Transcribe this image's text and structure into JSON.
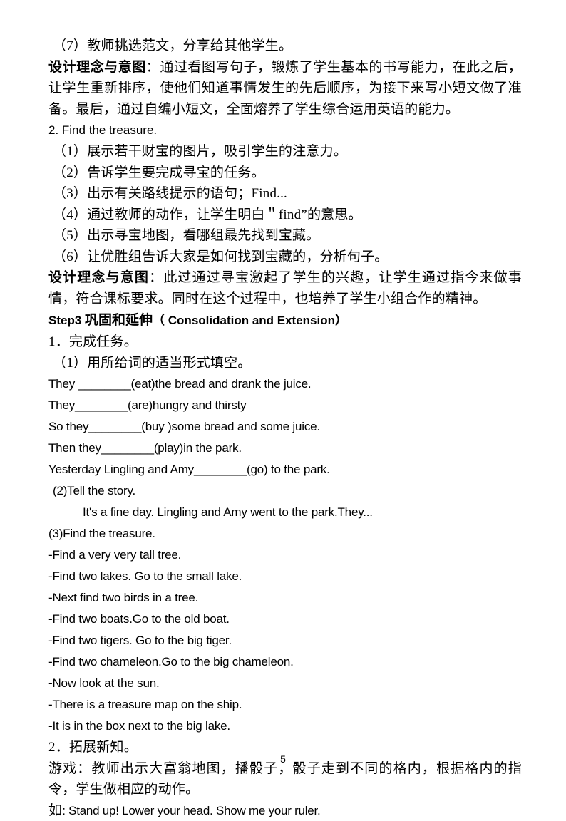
{
  "document": {
    "page_number": "5",
    "body": [
      {
        "id": "item-7",
        "script": "cn",
        "style": "cn",
        "indent": "hang",
        "text": "（7）教师挑选范文，分享给其他学生。"
      },
      {
        "id": "design-intent-1",
        "script": "cn",
        "style": "cn-mixed",
        "lead": "设计理念与意图",
        "text": "：通过看图写句子，锻炼了学生基本的书写能力，在此之后，让学生重新排序，使他们知道事情发生的先后顺序，为接下来写小短文做了准备。最后，通过自编小短文，全面熔养了学生综合运用英语的能力。"
      },
      {
        "id": "task-2-find-treasure",
        "script": "en",
        "style": "en-head",
        "text": "2. Find the treasure."
      },
      {
        "id": "item-2-1",
        "script": "cn",
        "style": "cn",
        "indent": "hang",
        "text": "（1）展示若干财宝的图片，吸引学生的注意力。"
      },
      {
        "id": "item-2-2",
        "script": "cn",
        "style": "cn",
        "indent": "hang",
        "text": "（2）告诉学生要完成寻宝的任务。"
      },
      {
        "id": "item-2-3",
        "script": "cn",
        "style": "cn",
        "indent": "hang",
        "text": "（3）出示有关路线提示的语句；Find..."
      },
      {
        "id": "item-2-4",
        "script": "cn",
        "style": "cn",
        "indent": "hang",
        "text": "（4）通过教师的动作，让学生明白＂find”的意思。"
      },
      {
        "id": "item-2-5",
        "script": "cn",
        "style": "cn",
        "indent": "hang",
        "text": "（5）出示寻宝地图，看哪组最先找到宝藏。"
      },
      {
        "id": "item-2-6",
        "script": "cn",
        "style": "cn",
        "indent": "hang",
        "text": "（6）让优胜组告诉大家是如何找到宝藏的，分析句子。"
      },
      {
        "id": "design-intent-2",
        "script": "cn",
        "style": "cn-mixed",
        "lead": "设计理念与意图",
        "text": "：此过通过寻宝激起了学生的兴趣，让学生通过指今来做事情，符合课标要求。同时在这个过程中，也培养了学生小组合作的精神。"
      },
      {
        "id": "step3-heading",
        "script": "mixed",
        "style": "step-head",
        "latin_prefix": "Step3 ",
        "cjk": "巩固和延伸",
        "latin_suffix": "（ Consolidation and Extension）"
      },
      {
        "id": "task-1-complete",
        "script": "cn",
        "style": "cn",
        "text": "1．完成任务。"
      },
      {
        "id": "item-1-1",
        "script": "cn",
        "style": "cn",
        "indent": "hang",
        "text": "（1）用所给词的适当形式填空。"
      },
      {
        "id": "fill-1",
        "script": "en",
        "style": "en",
        "text": "They ________(eat)the bread and drank the juice."
      },
      {
        "id": "fill-2",
        "script": "en",
        "style": "en",
        "text": "They________(are)hungry and thirsty"
      },
      {
        "id": "fill-3",
        "script": "en",
        "style": "en",
        "text": "So they________(buy )some bread and some juice."
      },
      {
        "id": "fill-4",
        "script": "en",
        "style": "en",
        "text": "Then they________(play)in the park."
      },
      {
        "id": "fill-5",
        "script": "en",
        "style": "en",
        "text": "Yesterday Lingling and Amy________(go) to the park."
      },
      {
        "id": "item-1-2",
        "script": "en",
        "style": "en",
        "indent": "hang",
        "text": "(2)Tell the story."
      },
      {
        "id": "story-sample",
        "script": "en",
        "style": "en",
        "indent": "deep",
        "text": "It's a fine day. Lingling and Amy went to the park.They..."
      },
      {
        "id": "item-1-3",
        "script": "en",
        "style": "en",
        "text": "(3)Find the treasure."
      },
      {
        "id": "clue-1",
        "script": "en",
        "style": "en",
        "text": "-Find a very very tall tree."
      },
      {
        "id": "clue-2",
        "script": "en",
        "style": "en",
        "text": "-Find two lakes. Go to the small lake."
      },
      {
        "id": "clue-3",
        "script": "en",
        "style": "en",
        "text": "-Next find two birds in a tree."
      },
      {
        "id": "clue-4",
        "script": "en",
        "style": "en",
        "text": "-Find two boats.Go to the old boat."
      },
      {
        "id": "clue-5",
        "script": "en",
        "style": "en",
        "text": "-Find two tigers. Go to the big tiger."
      },
      {
        "id": "clue-6",
        "script": "en",
        "style": "en",
        "text": "-Find two chameleon.Go to the big chameleon."
      },
      {
        "id": "clue-7",
        "script": "en",
        "style": "en",
        "text": "-Now look at the sun."
      },
      {
        "id": "clue-8",
        "script": "en",
        "style": "en",
        "text": "-There is a treasure map on the ship."
      },
      {
        "id": "clue-9",
        "script": "en",
        "style": "en",
        "text": "-It is in the box next to the big lake."
      },
      {
        "id": "task-2-extend",
        "script": "cn",
        "style": "cn",
        "text": "2．拓展新知。"
      },
      {
        "id": "game-desc",
        "script": "cn",
        "style": "cn",
        "text": "游戏：教师出示大富翁地图，播骰子，骰子走到不同的格内，根据格内的指令，学生做相应的动作。"
      },
      {
        "id": "game-example",
        "script": "mixed",
        "style": "cn-en-inline",
        "cjk": "如",
        "text": ": Stand up! Lower your head. Show me your ruler."
      }
    ]
  }
}
